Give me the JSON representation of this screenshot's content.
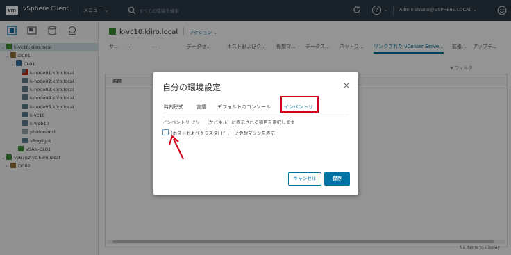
{
  "header": {
    "logo": "vm",
    "app_name": "vSphere Client",
    "menu_label": "メニュー",
    "search_placeholder": "すべての環境を検索",
    "user": "Administrator@VSPHERE.LOCAL"
  },
  "nav": {
    "tree": [
      {
        "label": "k-vc10.kiiro.local",
        "icon": "vcenter-icon"
      },
      {
        "label": "DC01",
        "icon": "datacenter-icon"
      },
      {
        "label": "CL01",
        "icon": "cluster-icon"
      },
      {
        "label": "k-node01.kiiro.local",
        "icon": "host-warning-icon"
      },
      {
        "label": "k-node02.kiiro.local",
        "icon": "host-icon"
      },
      {
        "label": "k-node03.kiiro.local",
        "icon": "host-icon"
      },
      {
        "label": "k-node04.kiiro.local",
        "icon": "host-icon"
      },
      {
        "label": "k-node05.kiiro.local",
        "icon": "host-icon"
      },
      {
        "label": "k-vc10",
        "icon": "vm-icon"
      },
      {
        "label": "k-web10",
        "icon": "vm-icon"
      },
      {
        "label": "photon-mst",
        "icon": "vm-gray-icon"
      },
      {
        "label": "vRoglight",
        "icon": "vm-icon"
      },
      {
        "label": "vSAN-CL01",
        "icon": "datastore-icon"
      },
      {
        "label": "vc67u2-vc.kiiro.local",
        "icon": "vcenter-icon"
      },
      {
        "label": "DC02",
        "icon": "datacenter-icon"
      }
    ]
  },
  "content": {
    "object_title": "k-vc10.kiiro.local",
    "actions_label": "アクション",
    "tabs": [
      "サ...",
      "...",
      "...",
      "データセ...",
      "ホストおよびク...",
      "仮想マ...",
      "データス...",
      "ネットワ...",
      "リンクされた vCenter Serve...",
      "拡張...",
      "アップデ..."
    ],
    "filter_label": "フィルタ",
    "grid_column": "名前",
    "footer": "No items to display"
  },
  "modal": {
    "title": "自分の環境設定",
    "tabs": [
      "時刻形式",
      "言語",
      "デフォルトのコンソール",
      "インベントリ"
    ],
    "active_tab": "インベントリ",
    "description": "インベントリ ツリー（左パネル）に表示される項目を選択します",
    "checkbox_label": "(ホストおよびクラスタ) ビューに仮想マシンを表示",
    "checkbox_checked": false,
    "cancel_label": "キャンセル",
    "save_label": "保存"
  },
  "colors": {
    "header_bg": "#2b3a47",
    "accent": "#0072a3",
    "annotation": "#d0021b"
  }
}
